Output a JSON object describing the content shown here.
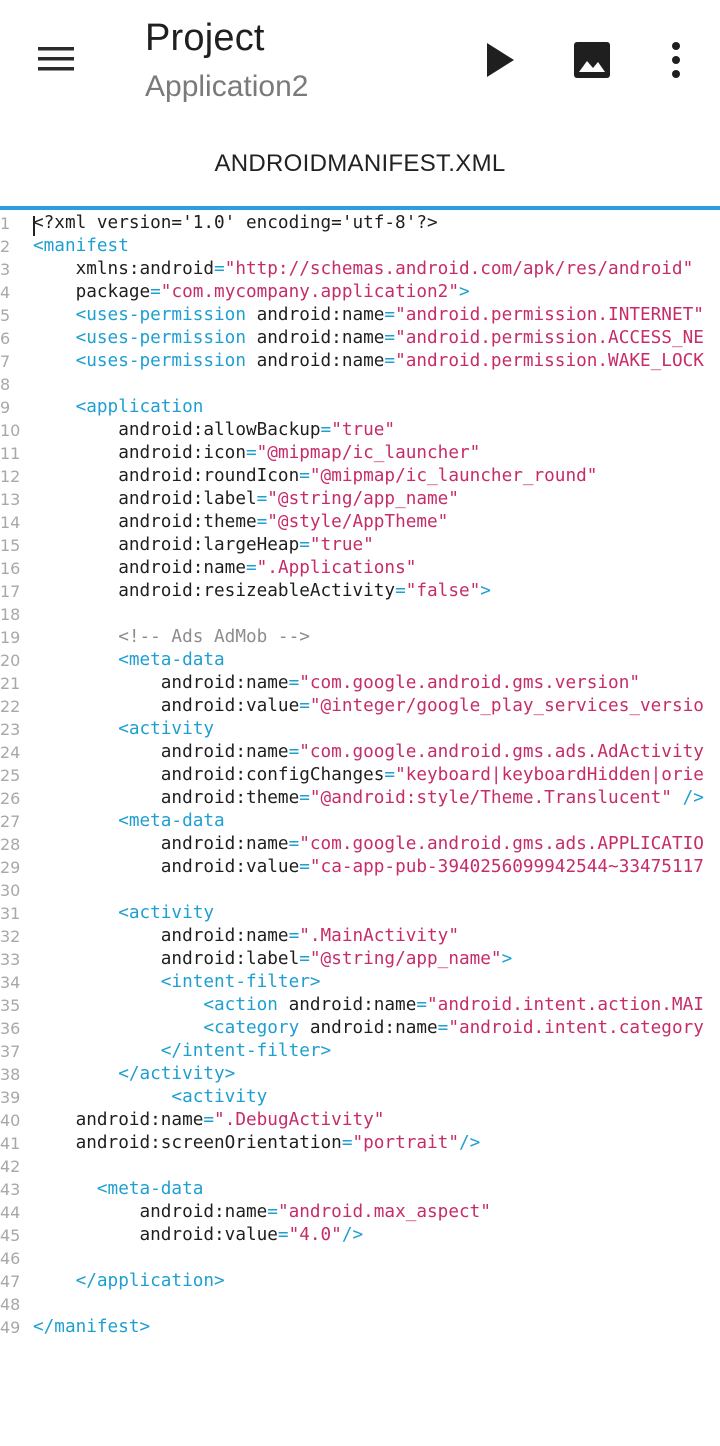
{
  "appbar": {
    "title": "Project",
    "subtitle": "Application2",
    "icons": [
      "menu-icon",
      "play-icon",
      "image-icon",
      "more-vert-icon"
    ]
  },
  "tab": {
    "label": "ANDROIDMANIFEST.XML"
  },
  "colors": {
    "accent": "#2a9fdc",
    "tag": "#1e9fd2",
    "string": "#c62c69",
    "comment": "#8c8c8c",
    "line_number": "#a8a8a8"
  },
  "editor": {
    "lines": [
      {
        "n": "1",
        "tokens": [
          [
            "t",
            "<?xml version='1.0' encoding='utf-8'?>"
          ]
        ]
      },
      {
        "n": "2",
        "tokens": [
          [
            "g",
            "<manifest"
          ]
        ]
      },
      {
        "n": "3",
        "tokens": [
          [
            "t",
            "    xmlns:android"
          ],
          [
            "e",
            "="
          ],
          [
            "s",
            "\"http://schemas.android.com/apk/res/android\""
          ]
        ]
      },
      {
        "n": "4",
        "tokens": [
          [
            "t",
            "    package"
          ],
          [
            "e",
            "="
          ],
          [
            "s",
            "\"com.mycompany.application2\""
          ],
          [
            "g",
            ">"
          ]
        ]
      },
      {
        "n": "5",
        "tokens": [
          [
            "g",
            "    <uses-permission"
          ],
          [
            "t",
            " android:name"
          ],
          [
            "e",
            "="
          ],
          [
            "s",
            "\"android.permission.INTERNET\""
          ]
        ]
      },
      {
        "n": "6",
        "tokens": [
          [
            "g",
            "    <uses-permission"
          ],
          [
            "t",
            " android:name"
          ],
          [
            "e",
            "="
          ],
          [
            "s",
            "\"android.permission.ACCESS_NE"
          ]
        ]
      },
      {
        "n": "7",
        "tokens": [
          [
            "g",
            "    <uses-permission"
          ],
          [
            "t",
            " android:name"
          ],
          [
            "e",
            "="
          ],
          [
            "s",
            "\"android.permission.WAKE_LOCK"
          ]
        ]
      },
      {
        "n": "8",
        "tokens": []
      },
      {
        "n": "9",
        "tokens": [
          [
            "g",
            "    <application"
          ]
        ]
      },
      {
        "n": "10",
        "tokens": [
          [
            "t",
            "        android:allowBackup"
          ],
          [
            "e",
            "="
          ],
          [
            "s",
            "\"true\""
          ]
        ]
      },
      {
        "n": "11",
        "tokens": [
          [
            "t",
            "        android:icon"
          ],
          [
            "e",
            "="
          ],
          [
            "s",
            "\"@mipmap/ic_launcher\""
          ]
        ]
      },
      {
        "n": "12",
        "tokens": [
          [
            "t",
            "        android:roundIcon"
          ],
          [
            "e",
            "="
          ],
          [
            "s",
            "\"@mipmap/ic_launcher_round\""
          ]
        ]
      },
      {
        "n": "13",
        "tokens": [
          [
            "t",
            "        android:label"
          ],
          [
            "e",
            "="
          ],
          [
            "s",
            "\"@string/app_name\""
          ]
        ]
      },
      {
        "n": "14",
        "tokens": [
          [
            "t",
            "        android:theme"
          ],
          [
            "e",
            "="
          ],
          [
            "s",
            "\"@style/AppTheme\""
          ]
        ]
      },
      {
        "n": "15",
        "tokens": [
          [
            "t",
            "        android:largeHeap"
          ],
          [
            "e",
            "="
          ],
          [
            "s",
            "\"true\""
          ]
        ]
      },
      {
        "n": "16",
        "tokens": [
          [
            "t",
            "        android:name"
          ],
          [
            "e",
            "="
          ],
          [
            "s",
            "\".Applications\""
          ]
        ]
      },
      {
        "n": "17",
        "tokens": [
          [
            "t",
            "        android:resizeableActivity"
          ],
          [
            "e",
            "="
          ],
          [
            "s",
            "\"false\""
          ],
          [
            "g",
            ">"
          ]
        ]
      },
      {
        "n": "18",
        "tokens": []
      },
      {
        "n": "19",
        "tokens": [
          [
            "c",
            "        <!-- Ads AdMob -->"
          ]
        ]
      },
      {
        "n": "20",
        "tokens": [
          [
            "g",
            "        <meta-data"
          ]
        ]
      },
      {
        "n": "21",
        "tokens": [
          [
            "t",
            "            android:name"
          ],
          [
            "e",
            "="
          ],
          [
            "s",
            "\"com.google.android.gms.version\""
          ]
        ]
      },
      {
        "n": "22",
        "tokens": [
          [
            "t",
            "            android:value"
          ],
          [
            "e",
            "="
          ],
          [
            "s",
            "\"@integer/google_play_services_versio"
          ]
        ]
      },
      {
        "n": "23",
        "tokens": [
          [
            "g",
            "        <activity"
          ]
        ]
      },
      {
        "n": "24",
        "tokens": [
          [
            "t",
            "            android:name"
          ],
          [
            "e",
            "="
          ],
          [
            "s",
            "\"com.google.android.gms.ads.AdActivity"
          ]
        ]
      },
      {
        "n": "25",
        "tokens": [
          [
            "t",
            "            android:configChanges"
          ],
          [
            "e",
            "="
          ],
          [
            "s",
            "\"keyboard|keyboardHidden|orie"
          ]
        ]
      },
      {
        "n": "26",
        "tokens": [
          [
            "t",
            "            android:theme"
          ],
          [
            "e",
            "="
          ],
          [
            "s",
            "\"@android:style/Theme.Translucent\""
          ],
          [
            "g",
            " />"
          ]
        ]
      },
      {
        "n": "27",
        "tokens": [
          [
            "g",
            "        <meta-data"
          ]
        ]
      },
      {
        "n": "28",
        "tokens": [
          [
            "t",
            "            android:name"
          ],
          [
            "e",
            "="
          ],
          [
            "s",
            "\"com.google.android.gms.ads.APPLICATIO"
          ]
        ]
      },
      {
        "n": "29",
        "tokens": [
          [
            "t",
            "            android:value"
          ],
          [
            "e",
            "="
          ],
          [
            "s",
            "\"ca-app-pub-3940256099942544~33475117"
          ]
        ]
      },
      {
        "n": "30",
        "tokens": []
      },
      {
        "n": "31",
        "tokens": [
          [
            "g",
            "        <activity"
          ]
        ]
      },
      {
        "n": "32",
        "tokens": [
          [
            "t",
            "            android:name"
          ],
          [
            "e",
            "="
          ],
          [
            "s",
            "\".MainActivity\""
          ]
        ]
      },
      {
        "n": "33",
        "tokens": [
          [
            "t",
            "            android:label"
          ],
          [
            "e",
            "="
          ],
          [
            "s",
            "\"@string/app_name\""
          ],
          [
            "g",
            ">"
          ]
        ]
      },
      {
        "n": "34",
        "tokens": [
          [
            "g",
            "            <intent-filter>"
          ]
        ]
      },
      {
        "n": "35",
        "tokens": [
          [
            "g",
            "                <action"
          ],
          [
            "t",
            " android:name"
          ],
          [
            "e",
            "="
          ],
          [
            "s",
            "\"android.intent.action.MAI"
          ]
        ]
      },
      {
        "n": "36",
        "tokens": [
          [
            "g",
            "                <category"
          ],
          [
            "t",
            " android:name"
          ],
          [
            "e",
            "="
          ],
          [
            "s",
            "\"android.intent.category"
          ]
        ]
      },
      {
        "n": "37",
        "tokens": [
          [
            "g",
            "            </intent-filter>"
          ]
        ]
      },
      {
        "n": "38",
        "tokens": [
          [
            "g",
            "        </activity>"
          ]
        ]
      },
      {
        "n": "39",
        "tokens": [
          [
            "g",
            "             <activity"
          ]
        ]
      },
      {
        "n": "40",
        "tokens": [
          [
            "t",
            "    android:name"
          ],
          [
            "e",
            "="
          ],
          [
            "s",
            "\".DebugActivity\""
          ]
        ]
      },
      {
        "n": "41",
        "tokens": [
          [
            "t",
            "    android:screenOrientation"
          ],
          [
            "e",
            "="
          ],
          [
            "s",
            "\"portrait\""
          ],
          [
            "g",
            "/>"
          ]
        ]
      },
      {
        "n": "42",
        "tokens": []
      },
      {
        "n": "43",
        "tokens": [
          [
            "g",
            "      <meta-data"
          ]
        ]
      },
      {
        "n": "44",
        "tokens": [
          [
            "t",
            "          android:name"
          ],
          [
            "e",
            "="
          ],
          [
            "s",
            "\"android.max_aspect\""
          ]
        ]
      },
      {
        "n": "45",
        "tokens": [
          [
            "t",
            "          android:value"
          ],
          [
            "e",
            "="
          ],
          [
            "s",
            "\"4.0\""
          ],
          [
            "g",
            "/>"
          ]
        ]
      },
      {
        "n": "46",
        "tokens": []
      },
      {
        "n": "47",
        "tokens": [
          [
            "g",
            "    </application>"
          ]
        ]
      },
      {
        "n": "48",
        "tokens": []
      },
      {
        "n": "49",
        "tokens": [
          [
            "g",
            "</manifest>"
          ]
        ]
      }
    ]
  }
}
